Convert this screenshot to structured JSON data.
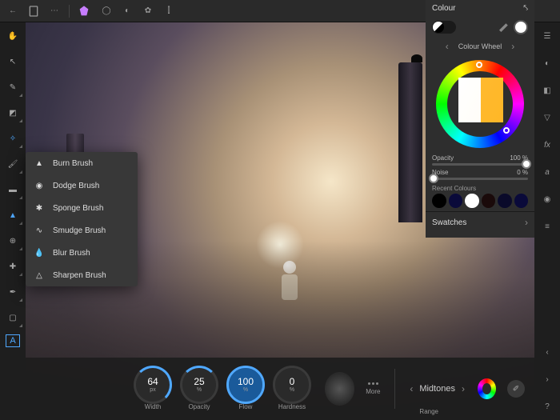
{
  "panels": {
    "colour": {
      "title": "Colour",
      "subtitle": "Colour Wheel",
      "opacity_label": "Opacity",
      "opacity_value": "100 %",
      "noise_label": "Noise",
      "noise_value": "0 %",
      "recent_label": "Recent Colours",
      "swatches_label": "Swatches",
      "recent": [
        "#000000",
        "#0a0a3a",
        "#ffffff",
        "#1a0a0a",
        "#0a0a2a",
        "#0a0a3a"
      ]
    }
  },
  "brush_flyout": [
    {
      "label": "Burn Brush",
      "icon": "flame"
    },
    {
      "label": "Dodge Brush",
      "icon": "circle"
    },
    {
      "label": "Sponge Brush",
      "icon": "sponge"
    },
    {
      "label": "Smudge Brush",
      "icon": "smudge"
    },
    {
      "label": "Blur Brush",
      "icon": "drop"
    },
    {
      "label": "Sharpen Brush",
      "icon": "triangle"
    }
  ],
  "bottom": {
    "dials": [
      {
        "value": "64",
        "unit": "px",
        "label": "Width",
        "pct": "p64"
      },
      {
        "value": "25",
        "unit": "%",
        "label": "Opacity",
        "pct": "p25"
      },
      {
        "value": "100",
        "unit": "%",
        "label": "Flow",
        "pct": "p100",
        "active": true
      },
      {
        "value": "0",
        "unit": "%",
        "label": "Hardness",
        "pct": ""
      }
    ],
    "more": "More",
    "range_value": "Midtones",
    "range_label": "Range"
  }
}
